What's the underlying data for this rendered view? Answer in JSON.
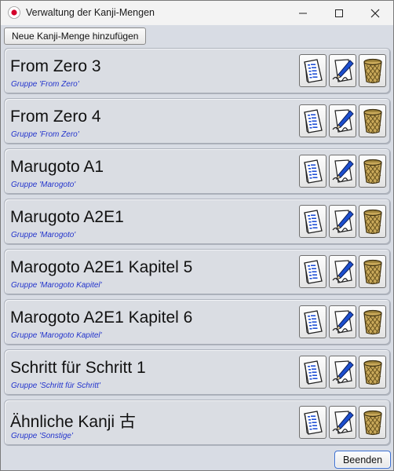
{
  "window": {
    "title": "Verwaltung der Kanji-Mengen",
    "icon": "japan-flag-icon"
  },
  "toolbar": {
    "add_label": "Neue Kanji-Menge hinzufügen"
  },
  "items": [
    {
      "title": "From Zero 3",
      "group": "Gruppe 'From Zero'"
    },
    {
      "title": "From Zero 4",
      "group": "Gruppe 'From Zero'"
    },
    {
      "title": "Marugoto A1",
      "group": "Gruppe 'Marogoto'"
    },
    {
      "title": "Marugoto A2E1",
      "group": "Gruppe 'Marogoto'"
    },
    {
      "title": "Marogoto A2E1 Kapitel 5",
      "group": "Gruppe 'Marogoto Kapitel'"
    },
    {
      "title": "Marogoto A2E1 Kapitel 6",
      "group": "Gruppe 'Marogoto Kapitel'"
    },
    {
      "title": "Schritt für Schritt 1",
      "group": "Gruppe 'Schritt für Schritt'"
    },
    {
      "title": "Ähnliche Kanji 古",
      "group": "Gruppe 'Sonstige'"
    }
  ],
  "footer": {
    "end_label": "Beenden"
  },
  "colors": {
    "group_text": "#2233cc",
    "panel_bg": "#d8dce4",
    "flag_red": "#d4002a"
  },
  "icons": [
    "list-icon",
    "edit-pencil-icon",
    "trash-basket-icon"
  ]
}
